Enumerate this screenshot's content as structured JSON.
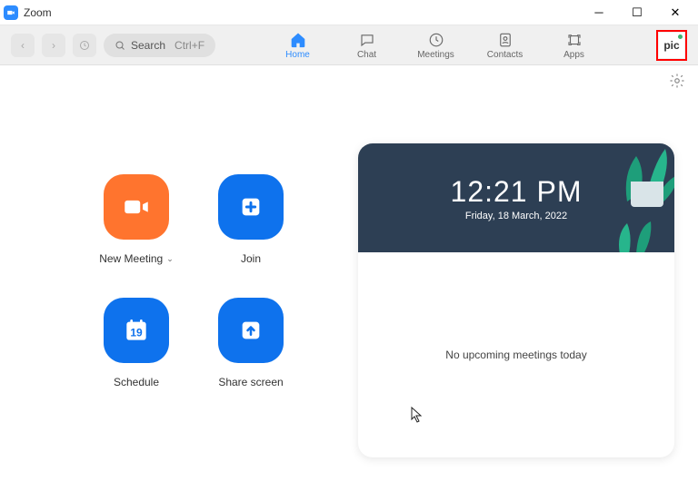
{
  "window": {
    "title": "Zoom"
  },
  "toolbar": {
    "search_label": "Search",
    "search_shortcut": "Ctrl+F",
    "tabs": [
      {
        "label": "Home"
      },
      {
        "label": "Chat"
      },
      {
        "label": "Meetings"
      },
      {
        "label": "Contacts"
      },
      {
        "label": "Apps"
      }
    ],
    "avatar_text": "pic"
  },
  "actions": {
    "new_meeting": "New Meeting",
    "join": "Join",
    "schedule": "Schedule",
    "schedule_day": "19",
    "share_screen": "Share screen"
  },
  "panel": {
    "time": "12:21 PM",
    "date": "Friday, 18 March, 2022",
    "no_meetings": "No upcoming meetings today"
  }
}
